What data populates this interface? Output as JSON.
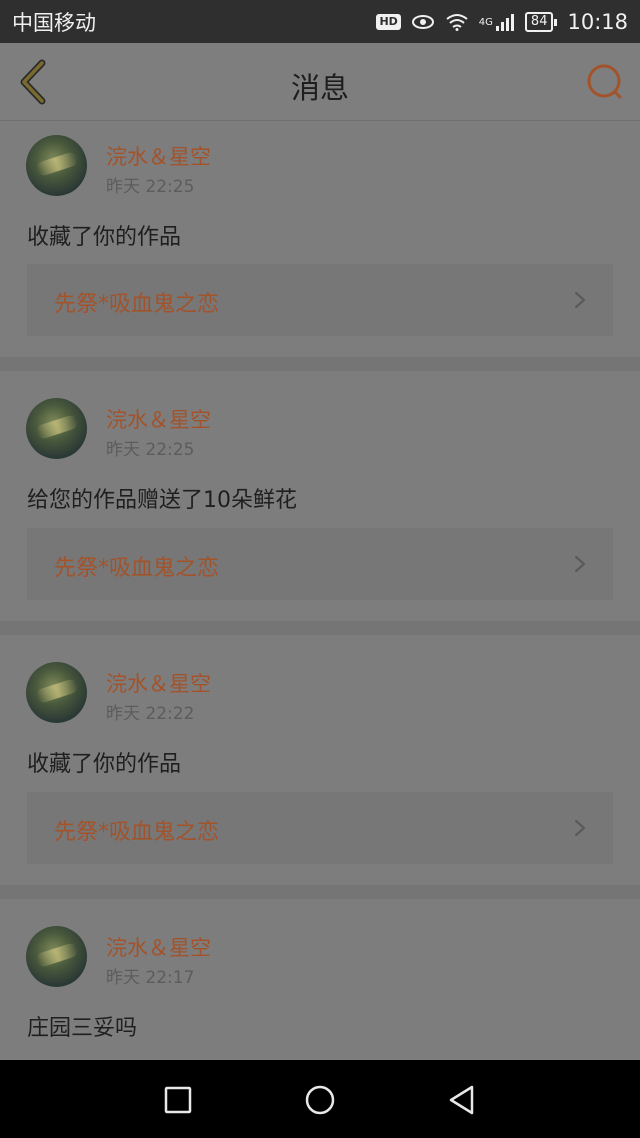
{
  "status_bar": {
    "carrier": "中国移动",
    "hd_badge": "HD",
    "network": "4G",
    "battery": "84",
    "time": "10:18"
  },
  "header": {
    "title": "消息",
    "back_icon": "chevron-left-icon",
    "search_icon": "search-icon"
  },
  "messages": [
    {
      "user": "浣水＆星空",
      "time": "昨天 22:25",
      "action": "收藏了你的作品",
      "work": "先祭*吸血鬼之恋"
    },
    {
      "user": "浣水＆星空",
      "time": "昨天 22:25",
      "action": "给您的作品赠送了10朵鲜花",
      "work": "先祭*吸血鬼之恋"
    },
    {
      "user": "浣水＆星空",
      "time": "昨天 22:22",
      "action": "收藏了你的作品",
      "work": "先祭*吸血鬼之恋"
    },
    {
      "user": "浣水＆星空",
      "time": "昨天 22:17",
      "action": "庄园三妥吗",
      "work": ""
    }
  ],
  "system_nav": {
    "recent_icon": "square-icon",
    "home_icon": "circle-icon",
    "back_icon": "triangle-back-icon"
  },
  "colors": {
    "accent": "#a3532a",
    "overlay_background": "#7d7d7d",
    "status_bar": "#2f2f2f"
  }
}
